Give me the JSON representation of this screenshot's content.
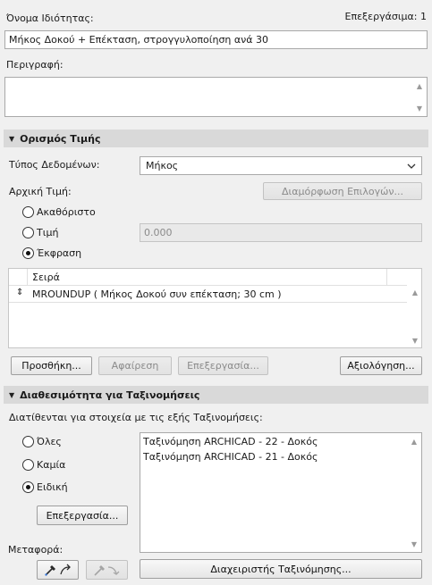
{
  "property": {
    "name_label": "Όνομα Ιδιότητας:",
    "edit_count": "Επεξεργάσιμα: 1",
    "name_value": "Μήκος Δοκού + Επέκταση, στρογγυλοποίηση ανά 30",
    "description_label": "Περιγραφή:",
    "description_value": ""
  },
  "value_definition": {
    "header": "Ορισμός Τιμής",
    "data_type_label": "Τύπος Δεδομένων:",
    "data_type_value": "Μήκος",
    "initial_value_label": "Αρχική Τιμή:",
    "configure_options_button": "Διαμόρφωση Επιλογών...",
    "radio_undefined": "Ακαθόριστο",
    "radio_value": "Τιμή",
    "value_input": "0.000",
    "radio_expression": "Έκφραση",
    "selected": "expression",
    "table_header": "Σειρά",
    "expressions": [
      "MROUNDUP ( Μήκος Δοκού συν επέκταση; 30 cm )"
    ],
    "add_button": "Προσθήκη...",
    "remove_button": "Αφαίρεση",
    "edit_button": "Επεξεργασία...",
    "evaluate_button": "Αξιολόγηση..."
  },
  "classification": {
    "header": "Διαθεσιμότητα για Ταξινομήσεις",
    "available_label": "Διατίθενται για στοιχεία με τις εξής Ταξινομήσεις:",
    "radio_all": "Όλες",
    "radio_none": "Καμία",
    "radio_custom": "Ειδική",
    "selected": "custom",
    "edit_button": "Επεξεργασία...",
    "items": [
      "Ταξινόμηση ARCHICAD - 22 - Δοκός",
      "Ταξινόμηση ARCHICAD - 21 - Δοκός"
    ],
    "transfer_label": "Μεταφορά:",
    "manager_button": "Διαχειριστής Ταξινόμησης..."
  }
}
